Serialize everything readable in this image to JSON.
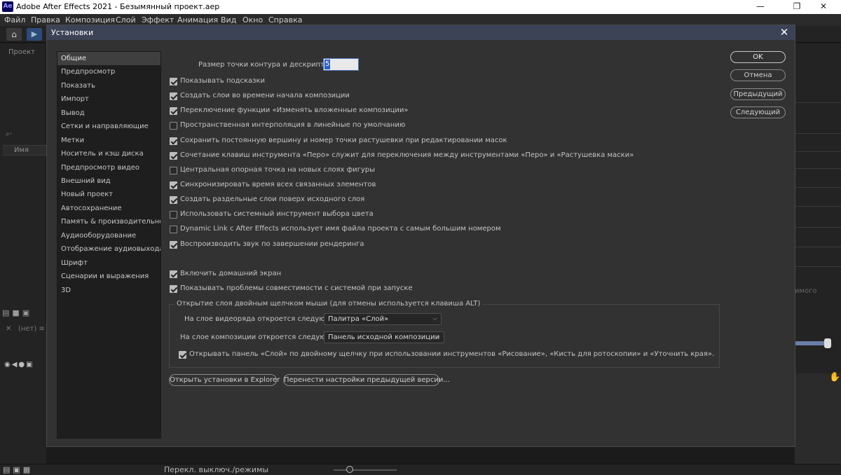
{
  "window": {
    "title": "Adobe After Effects 2021 - Безымянный проект.aep",
    "app_icon": "Ae"
  },
  "menu": [
    "Файл",
    "Правка",
    "Композиция",
    "Слой",
    "Эффект",
    "Анимация",
    "Вид",
    "Окно",
    "Справка"
  ],
  "host": {
    "project_panel_title": "Проект",
    "name_column": "Имя",
    "none_label": "(нет)",
    "status_switch_label": "Перекл. выключ./режимы",
    "clip_text": "имого"
  },
  "dialog": {
    "title": "Установки",
    "categories": [
      "Общие",
      "Предпросмотр",
      "Показать",
      "Импорт",
      "Вывод",
      "Сетки и направляющие",
      "Метки",
      "Носитель и кэш диска",
      "Предпросмотр видео",
      "Внешний вид",
      "Новый проект",
      "Автосохранение",
      "Память & производительность",
      "Аудиооборудование",
      "Отображение аудиовыхода",
      "Шрифт",
      "Сценарии и выражения",
      "3D"
    ],
    "selected_category": "Общие",
    "path_size_label": "Размер точки контура и дескриптора:",
    "path_size_value": "5",
    "options": [
      {
        "label": "Показывать подсказки",
        "checked": true
      },
      {
        "label": "Создать слои во времени начала композиции",
        "checked": true
      },
      {
        "label": "Переключение функции «Изменять вложенные композиции»",
        "checked": true
      },
      {
        "label": "Пространственная интерполяция в линейные по умолчанию",
        "checked": false
      },
      {
        "label": "Сохранить постоянную вершину и номер точки растушевки при редактировании масок",
        "checked": true
      },
      {
        "label": "Сочетание клавиш инструмента «Перо» служит для переключения между инструментами «Перо» и «Растушевка маски»",
        "checked": true
      },
      {
        "label": "Центральная опорная точка на новых слоях фигуры",
        "checked": false
      },
      {
        "label": "Синхронизировать время всех связанных элементов",
        "checked": true
      },
      {
        "label": "Создать раздельные слои поверх исходного слоя",
        "checked": true
      },
      {
        "label": "Использовать системный инструмент выбора цвета",
        "checked": false
      },
      {
        "label": "Dynamic Link с After Effects использует имя файла проекта с самым большим номером",
        "checked": false
      },
      {
        "label": "Воспроизводить звук по завершении рендеринга",
        "checked": true
      }
    ],
    "options2": [
      {
        "label": "Включить домашний экран",
        "checked": true
      },
      {
        "label": "Показывать проблемы совместимости с системой при запуске",
        "checked": true
      }
    ],
    "group_title": "Открытие слоя двойным щелчком мыши (для отмены используется клавиша ALT)",
    "footage_label": "На слое видеоряда откроется следующее:",
    "footage_value": "Палитра «Слой»",
    "comp_label": "На слое композиции откроется следующее:",
    "comp_value": "Панель исходной композиции",
    "open_layer_panel": {
      "label": "Открывать панель «Слой» по двойному щелчку при использовании инструментов «Рисование», «Кисть для ротоскопии» и «Уточнить края».",
      "checked": true
    },
    "reveal_button": "Открыть установки в Explorer",
    "migrate_button": "Перенести настройки предыдущей версии...",
    "buttons": {
      "ok": "OK",
      "cancel": "Отмена",
      "previous": "Предыдущий",
      "next": "Следующий"
    }
  },
  "colors": {
    "dialog_title_bg": "#3d4357",
    "selection_blue": "#2a5ec8",
    "panel_bg": "#323232"
  }
}
